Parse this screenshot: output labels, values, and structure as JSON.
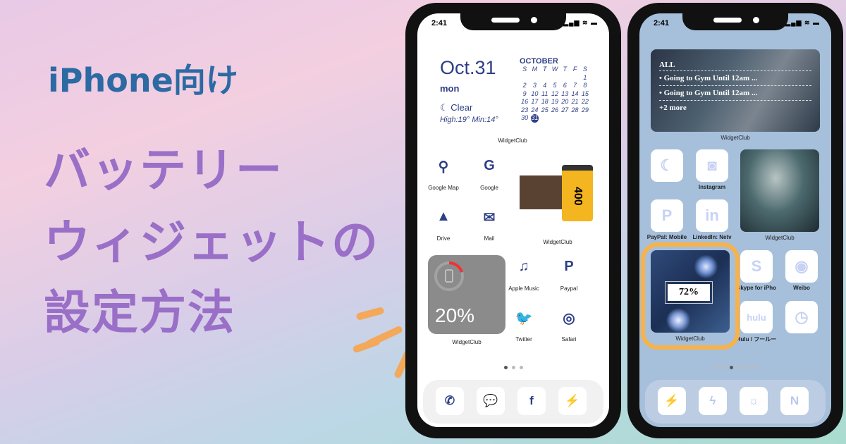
{
  "headline": {
    "line1": "iPhone向け",
    "line2": "バッテリー",
    "line3": "ウィジェットの",
    "line4": "設定方法"
  },
  "colors": {
    "headline_blue": "#2c6aa3",
    "headline_purple": "#9a6fc7",
    "accent_orange": "#f4a85a",
    "navy": "#2e3f86"
  },
  "left_phone": {
    "time": "2:41",
    "status": "▂▄▆ ≋ ▬",
    "date_widget": {
      "date": "Oct.31",
      "weekday": "mon",
      "weather": "Clear",
      "weather_icon": "moon-icon",
      "temps": "High:19° Min:14°"
    },
    "calendar": {
      "month": "OCTOBER",
      "days_header": [
        "S",
        "M",
        "T",
        "W",
        "T",
        "F",
        "S"
      ],
      "rows": [
        [
          "",
          "",
          "",
          "",
          "",
          "",
          "1"
        ],
        [
          "2",
          "3",
          "4",
          "5",
          "6",
          "7",
          "8"
        ],
        [
          "9",
          "10",
          "11",
          "12",
          "13",
          "14",
          "15"
        ],
        [
          "16",
          "17",
          "18",
          "19",
          "20",
          "21",
          "22"
        ],
        [
          "23",
          "24",
          "25",
          "26",
          "27",
          "28",
          "29"
        ],
        [
          "30",
          "31",
          "",
          "",
          "",
          "",
          ""
        ]
      ],
      "today": "31"
    },
    "widget_label": "WidgetClub",
    "apps": [
      {
        "label": "Google Map",
        "icon": "map-pin-icon"
      },
      {
        "label": "Google",
        "icon": "google-icon"
      },
      {
        "label": "Drive",
        "icon": "drive-icon"
      },
      {
        "label": "Mail",
        "icon": "mail-icon"
      },
      {
        "label": "Apple Music",
        "icon": "music-icon"
      },
      {
        "label": "Paypal",
        "icon": "paypal-icon"
      },
      {
        "label": "Twitter",
        "icon": "twitter-icon"
      },
      {
        "label": "Safari",
        "icon": "compass-icon"
      }
    ],
    "film_widget_label": "WidgetClub",
    "film_text": "400",
    "battery_widget": {
      "percent": "20%",
      "level": 20,
      "label": "WidgetClub"
    },
    "page_dots": 3,
    "active_dot": 0,
    "dock": [
      "phone-icon",
      "message-icon",
      "facebook-icon",
      "messenger-icon"
    ]
  },
  "right_phone": {
    "time": "2:41",
    "status": "▂▄▆ ≋ ▬",
    "reminder_widget": {
      "title": "ALL",
      "items": [
        "• Going to Gym Until 12am ...",
        "• Going to Gym Until 12am ..."
      ],
      "more": "+2 more",
      "label": "WidgetClub"
    },
    "apps": [
      {
        "label": "",
        "icon": "moon-icon"
      },
      {
        "label": "Instagram",
        "icon": "instagram-icon"
      },
      {
        "label": "PayPal: Mobile",
        "icon": "paypal-icon"
      },
      {
        "label": "LinkedIn: Netv",
        "icon": "linkedin-icon"
      },
      {
        "label": "Skype for iPho",
        "icon": "skype-icon"
      },
      {
        "label": "Weibo",
        "icon": "weibo-icon"
      },
      {
        "label": "Hulu / フールー",
        "icon": "hulu-icon"
      },
      {
        "label": "",
        "icon": "clock-icon"
      }
    ],
    "angel_widget_label": "WidgetClub",
    "battery_widget": {
      "percent": "72%",
      "level": 72,
      "label": "WidgetClub"
    },
    "page_dots": 6,
    "active_dot": 2,
    "dock": [
      "messenger-icon",
      "bolt-icon",
      "weather-icon",
      "notion-icon"
    ]
  }
}
